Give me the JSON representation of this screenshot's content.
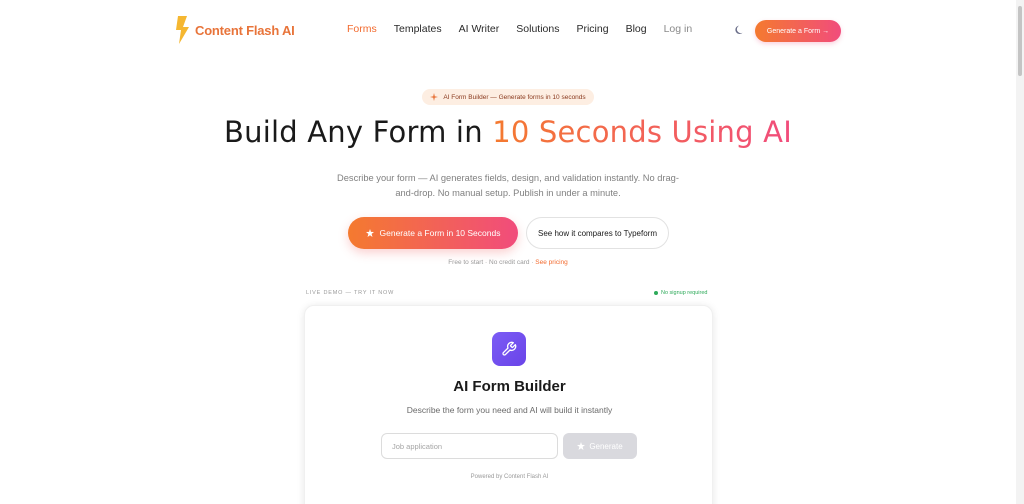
{
  "nav": {
    "brand": "Content Flash AI",
    "links": [
      {
        "label": "Forms",
        "active": true
      },
      {
        "label": "Templates",
        "active": false
      },
      {
        "label": "AI Writer",
        "active": false
      },
      {
        "label": "Solutions",
        "active": false
      },
      {
        "label": "Pricing",
        "active": false
      },
      {
        "label": "Blog",
        "active": false
      }
    ],
    "login": "Log in",
    "theme_icon": "moon-icon",
    "cta": "Generate a Form →"
  },
  "hero": {
    "badge": "AI Form Builder — Generate forms in 10 seconds",
    "headline_plain": "Build Any Form in ",
    "headline_accent": "10 Seconds Using AI",
    "subhead": "Describe your form — AI generates fields, design, and validation instantly. No drag-and-drop. No manual setup. Publish in under a minute.",
    "primary_button": "Generate a Form in 10 Seconds",
    "secondary_button": "See how it compares to Typeform",
    "fineprint_text": "Free to start · No credit card · ",
    "fineprint_link": "See pricing"
  },
  "demo": {
    "label": "LIVE DEMO — TRY IT NOW",
    "no_signup": "No signup required",
    "card": {
      "icon": "wrench-icon",
      "title": "AI Form Builder",
      "subtitle": "Describe the form you need and AI will build it instantly",
      "input_value": "",
      "input_placeholder": "Job application",
      "generate_button": "Generate",
      "powered_by": "Powered by Content Flash AI"
    }
  },
  "colors": {
    "accent_orange": "#f47a2f",
    "accent_pink": "#f14c7c",
    "icon_purple": "#7b5cf5",
    "success_green": "#2eaa5a"
  }
}
